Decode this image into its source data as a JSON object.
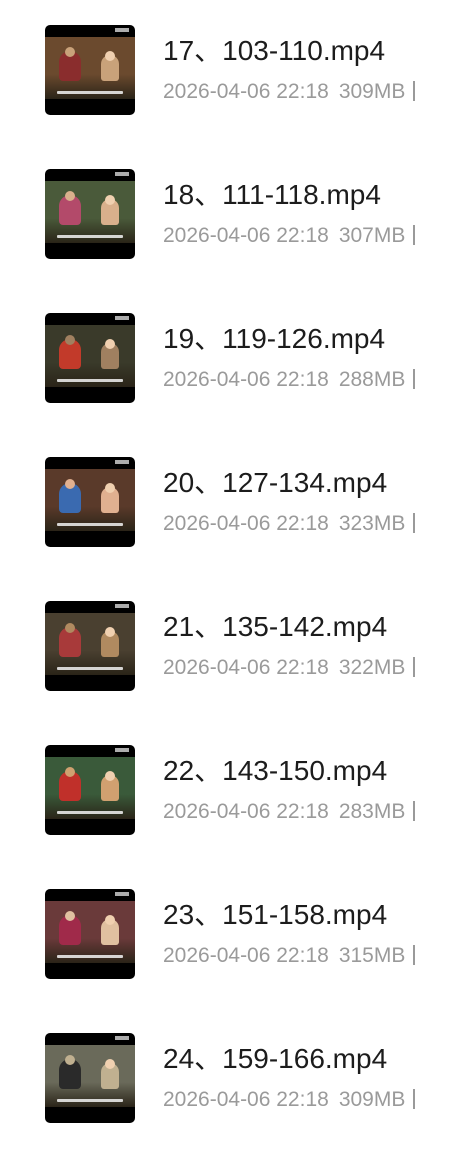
{
  "files": [
    {
      "name": "17、103-110.mp4",
      "date": "2026-04-06 22:18",
      "size": "309MB",
      "thumb_colors": [
        "#6b4a2e",
        "#c9a27a",
        "#8a2d2d"
      ]
    },
    {
      "name": "18、111-118.mp4",
      "date": "2026-04-06 22:18",
      "size": "307MB",
      "thumb_colors": [
        "#4a5a3a",
        "#d9b08c",
        "#b34a6a"
      ]
    },
    {
      "name": "19、119-126.mp4",
      "date": "2026-04-06 22:18",
      "size": "288MB",
      "thumb_colors": [
        "#3a3a2a",
        "#a08060",
        "#c23a2a"
      ]
    },
    {
      "name": "20、127-134.mp4",
      "date": "2026-04-06 22:18",
      "size": "323MB",
      "thumb_colors": [
        "#5a3a2a",
        "#e0b090",
        "#3a6ab0"
      ]
    },
    {
      "name": "21、135-142.mp4",
      "date": "2026-04-06 22:18",
      "size": "322MB",
      "thumb_colors": [
        "#4a4030",
        "#b08a60",
        "#a83a3a"
      ]
    },
    {
      "name": "22、143-150.mp4",
      "date": "2026-04-06 22:18",
      "size": "283MB",
      "thumb_colors": [
        "#3a5a3a",
        "#d0a070",
        "#c0302a"
      ]
    },
    {
      "name": "23、151-158.mp4",
      "date": "2026-04-06 22:18",
      "size": "315MB",
      "thumb_colors": [
        "#6a3a3a",
        "#e0c0a0",
        "#a02a4a"
      ]
    },
    {
      "name": "24、159-166.mp4",
      "date": "2026-04-06 22:18",
      "size": "309MB",
      "thumb_colors": [
        "#6a6a5a",
        "#c0b090",
        "#2a2a2a"
      ]
    }
  ]
}
